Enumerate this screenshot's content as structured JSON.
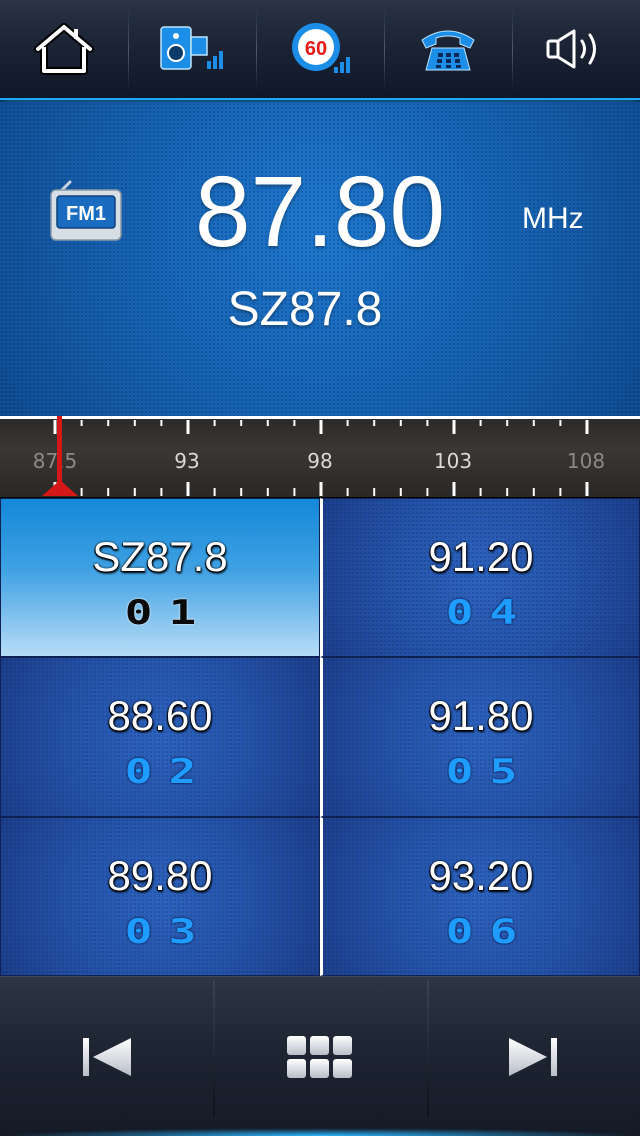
{
  "topbar": {
    "buttons": [
      {
        "name": "home",
        "icon": "home-icon"
      },
      {
        "name": "speed-camera",
        "icon": "speed-camera-icon"
      },
      {
        "name": "speed-limit",
        "icon": "speed-limit-icon",
        "value": "60"
      },
      {
        "name": "phone",
        "icon": "phone-icon"
      },
      {
        "name": "volume",
        "icon": "speaker-icon"
      }
    ],
    "accent": "#1ea8ff"
  },
  "radio": {
    "band": "FM1",
    "frequency": "87.80",
    "unit": "MHz",
    "station": "SZ87.8"
  },
  "scale": {
    "labels": [
      "87.5",
      "93",
      "98",
      "103",
      "108"
    ],
    "needle_color": "#d41818"
  },
  "presets": [
    {
      "freq": "SZ87.8",
      "num": "01",
      "active": true
    },
    {
      "freq": "91.20",
      "num": "04",
      "active": false
    },
    {
      "freq": "88.60",
      "num": "02",
      "active": false
    },
    {
      "freq": "91.80",
      "num": "05",
      "active": false
    },
    {
      "freq": "89.80",
      "num": "03",
      "active": false
    },
    {
      "freq": "93.20",
      "num": "06",
      "active": false
    }
  ],
  "bottombar": {
    "buttons": [
      {
        "name": "previous",
        "icon": "skip-previous-icon"
      },
      {
        "name": "menu",
        "icon": "grid-menu-icon"
      },
      {
        "name": "next",
        "icon": "skip-next-icon"
      }
    ]
  }
}
